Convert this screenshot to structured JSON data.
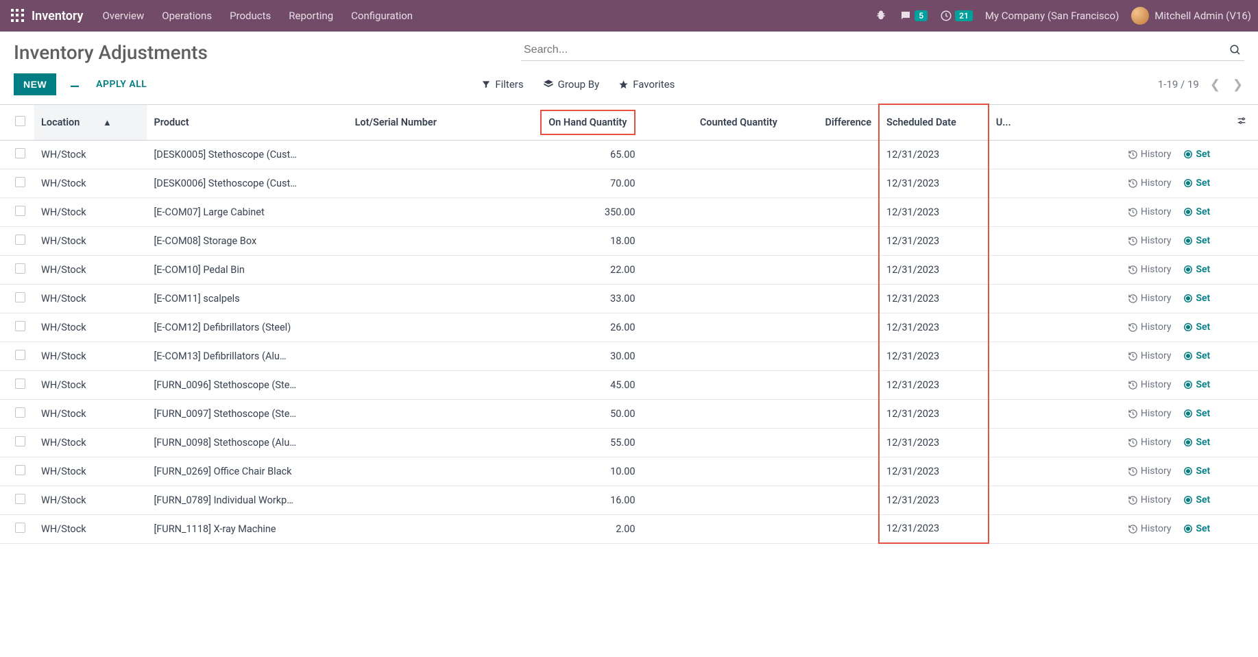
{
  "nav": {
    "brand": "Inventory",
    "items": [
      "Overview",
      "Operations",
      "Products",
      "Reporting",
      "Configuration"
    ],
    "messages_badge": "5",
    "activities_badge": "21",
    "company": "My Company (San Francisco)",
    "user": "Mitchell Admin (V16)"
  },
  "cp": {
    "title": "Inventory Adjustments",
    "search_placeholder": "Search...",
    "new_btn": "NEW",
    "apply_all": "APPLY ALL",
    "filters": "Filters",
    "group_by": "Group By",
    "favorites": "Favorites",
    "pager": "1-19 / 19"
  },
  "columns": {
    "location": "Location",
    "product": "Product",
    "lot": "Lot/Serial Number",
    "on_hand": "On Hand Quantity",
    "counted": "Counted Quantity",
    "difference": "Difference",
    "scheduled": "Scheduled Date",
    "user": "U..."
  },
  "row_actions": {
    "history": "History",
    "set": "Set"
  },
  "rows": [
    {
      "location": "WH/Stock",
      "product": "[DESK0005] Stethoscope (Cust…",
      "on_hand": "65.00",
      "scheduled": "12/31/2023"
    },
    {
      "location": "WH/Stock",
      "product": "[DESK0006] Stethoscope (Cust…",
      "on_hand": "70.00",
      "scheduled": "12/31/2023"
    },
    {
      "location": "WH/Stock",
      "product": "[E-COM07] Large Cabinet",
      "on_hand": "350.00",
      "scheduled": "12/31/2023"
    },
    {
      "location": "WH/Stock",
      "product": "[E-COM08] Storage Box",
      "on_hand": "18.00",
      "scheduled": "12/31/2023"
    },
    {
      "location": "WH/Stock",
      "product": "[E-COM10] Pedal Bin",
      "on_hand": "22.00",
      "scheduled": "12/31/2023"
    },
    {
      "location": "WH/Stock",
      "product": "[E-COM11] scalpels",
      "on_hand": "33.00",
      "scheduled": "12/31/2023"
    },
    {
      "location": "WH/Stock",
      "product": "[E-COM12] Defibrillators (Steel)",
      "on_hand": "26.00",
      "scheduled": "12/31/2023"
    },
    {
      "location": "WH/Stock",
      "product": "[E-COM13] Defibrillators (Alu…",
      "on_hand": "30.00",
      "scheduled": "12/31/2023"
    },
    {
      "location": "WH/Stock",
      "product": "[FURN_0096] Stethoscope (Ste…",
      "on_hand": "45.00",
      "scheduled": "12/31/2023"
    },
    {
      "location": "WH/Stock",
      "product": "[FURN_0097] Stethoscope (Ste…",
      "on_hand": "50.00",
      "scheduled": "12/31/2023"
    },
    {
      "location": "WH/Stock",
      "product": "[FURN_0098] Stethoscope (Alu…",
      "on_hand": "55.00",
      "scheduled": "12/31/2023"
    },
    {
      "location": "WH/Stock",
      "product": "[FURN_0269] Office Chair Black",
      "on_hand": "10.00",
      "scheduled": "12/31/2023"
    },
    {
      "location": "WH/Stock",
      "product": "[FURN_0789] Individual Workp…",
      "on_hand": "16.00",
      "scheduled": "12/31/2023"
    },
    {
      "location": "WH/Stock",
      "product": "[FURN_1118] X-ray Machine",
      "on_hand": "2.00",
      "scheduled": "12/31/2023"
    }
  ]
}
